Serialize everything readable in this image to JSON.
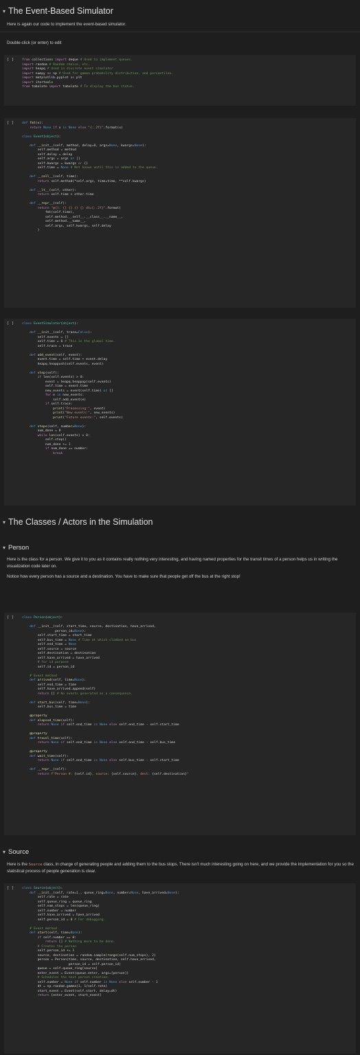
{
  "sections": {
    "event_sim": "The Event-Based Simulator",
    "classes": "The Classes / Actors in the Simulation",
    "person": "Person",
    "source": "Source"
  },
  "markdown": {
    "intro": "Here is again our code to implement the event-based simulator.",
    "edit_hint": "Double-click (or enter) to edit",
    "person_p1": "Here is the class for a person. We give it to you as it contains really nothing very interesting, and having named properties for the transit times of a person helps us in writing the visualization code later on.",
    "person_p2": "Notice how every person has a source and a destination. You have to make sure that people get off the bus at the right stop!",
    "source_pre": "Here is the ",
    "source_code": "Source",
    "source_post": " class, in charge of generating people and adding them to the bus stops. There isn't much interesting going on here, and we provide the implementation for you so the statistical process of people generation is clear."
  },
  "cells": {
    "run_marker": "[ ]"
  },
  "icons": {
    "section_toggle": "chevron-down-icon"
  }
}
